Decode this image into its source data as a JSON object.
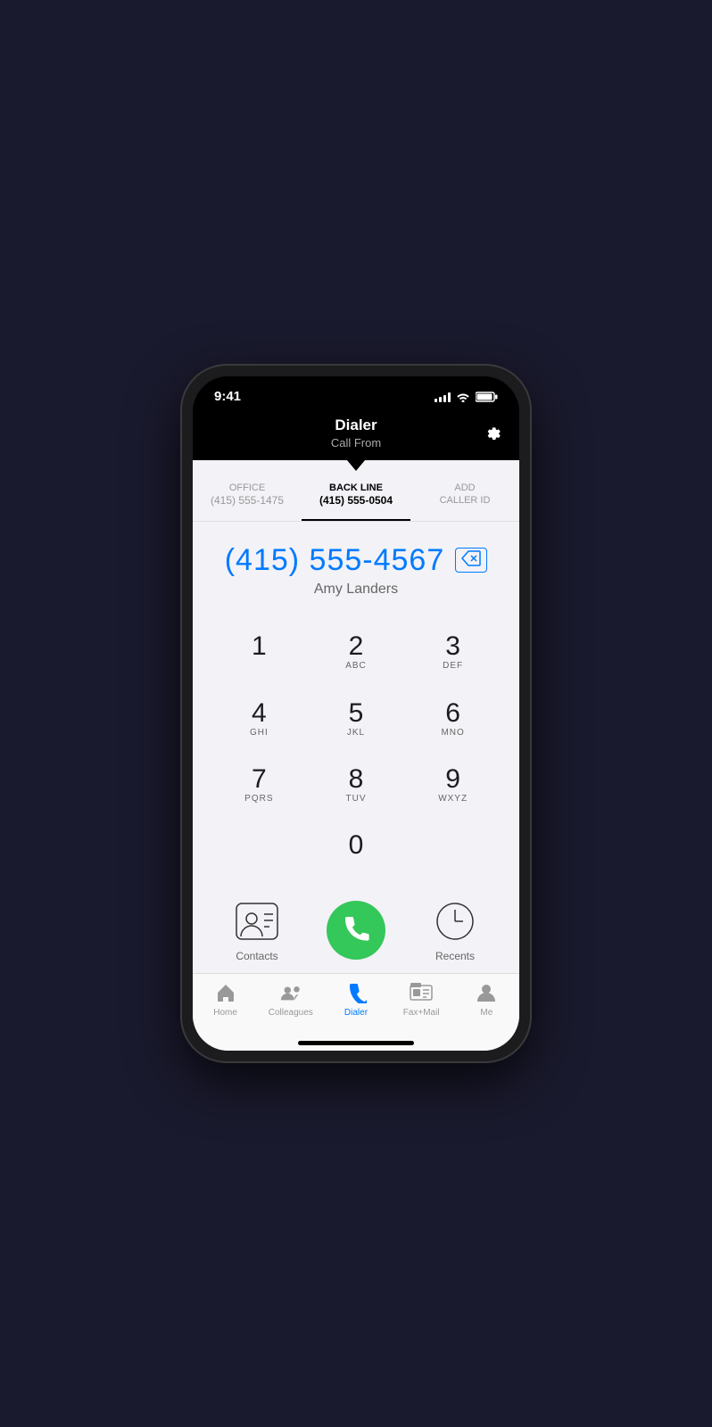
{
  "statusBar": {
    "time": "9:41"
  },
  "header": {
    "title": "Dialer",
    "subtitle": "Call From",
    "settingsLabel": "settings"
  },
  "callerTabs": [
    {
      "id": "office",
      "label": "OFFICE",
      "number": "(415) 555-1475",
      "active": false
    },
    {
      "id": "backline",
      "label": "BACK LINE",
      "number": "(415) 555-0504",
      "active": true
    },
    {
      "id": "add",
      "label": "ADD CALLER ID",
      "number": "",
      "active": false
    }
  ],
  "dialDisplay": {
    "number": "(415) 555-4567",
    "contactName": "Amy Landers",
    "deleteLabel": "⌫"
  },
  "dialpad": {
    "rows": [
      [
        {
          "digit": "1",
          "letters": ""
        },
        {
          "digit": "2",
          "letters": "ABC"
        },
        {
          "digit": "3",
          "letters": "DEF"
        }
      ],
      [
        {
          "digit": "4",
          "letters": "GHI"
        },
        {
          "digit": "5",
          "letters": "JKL"
        },
        {
          "digit": "6",
          "letters": "MNO"
        }
      ],
      [
        {
          "digit": "7",
          "letters": "PQRS"
        },
        {
          "digit": "8",
          "letters": "TUV"
        },
        {
          "digit": "9",
          "letters": "WXYZ"
        }
      ],
      [
        {
          "digit": "",
          "letters": ""
        },
        {
          "digit": "0",
          "letters": ""
        },
        {
          "digit": "",
          "letters": ""
        }
      ]
    ]
  },
  "bottomActions": {
    "contacts": "Contacts",
    "recents": "Recents"
  },
  "tabBar": {
    "items": [
      {
        "id": "home",
        "label": "Home",
        "active": false
      },
      {
        "id": "colleagues",
        "label": "Colleagues",
        "active": false
      },
      {
        "id": "dialer",
        "label": "Dialer",
        "active": true
      },
      {
        "id": "faxmail",
        "label": "Fax+Mail",
        "active": false
      },
      {
        "id": "me",
        "label": "Me",
        "active": false
      }
    ]
  }
}
